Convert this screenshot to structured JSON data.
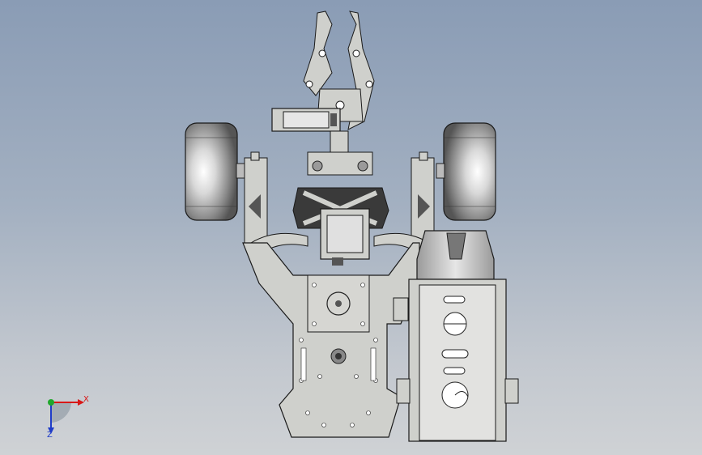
{
  "viewport": {
    "background_top": "#8a9cb5",
    "background_bottom": "#cfd2d5"
  },
  "model": {
    "part_fill": "#cfd0cc",
    "part_dark": "#4a4a4a",
    "edge_color": "#1a1a1a",
    "wheel_highlight": "#ffffff"
  },
  "triad": {
    "x_label": "X",
    "z_label": "Z",
    "x_color": "#d81818",
    "y_color": "#1fa82c",
    "z_color": "#1f3cc8"
  }
}
